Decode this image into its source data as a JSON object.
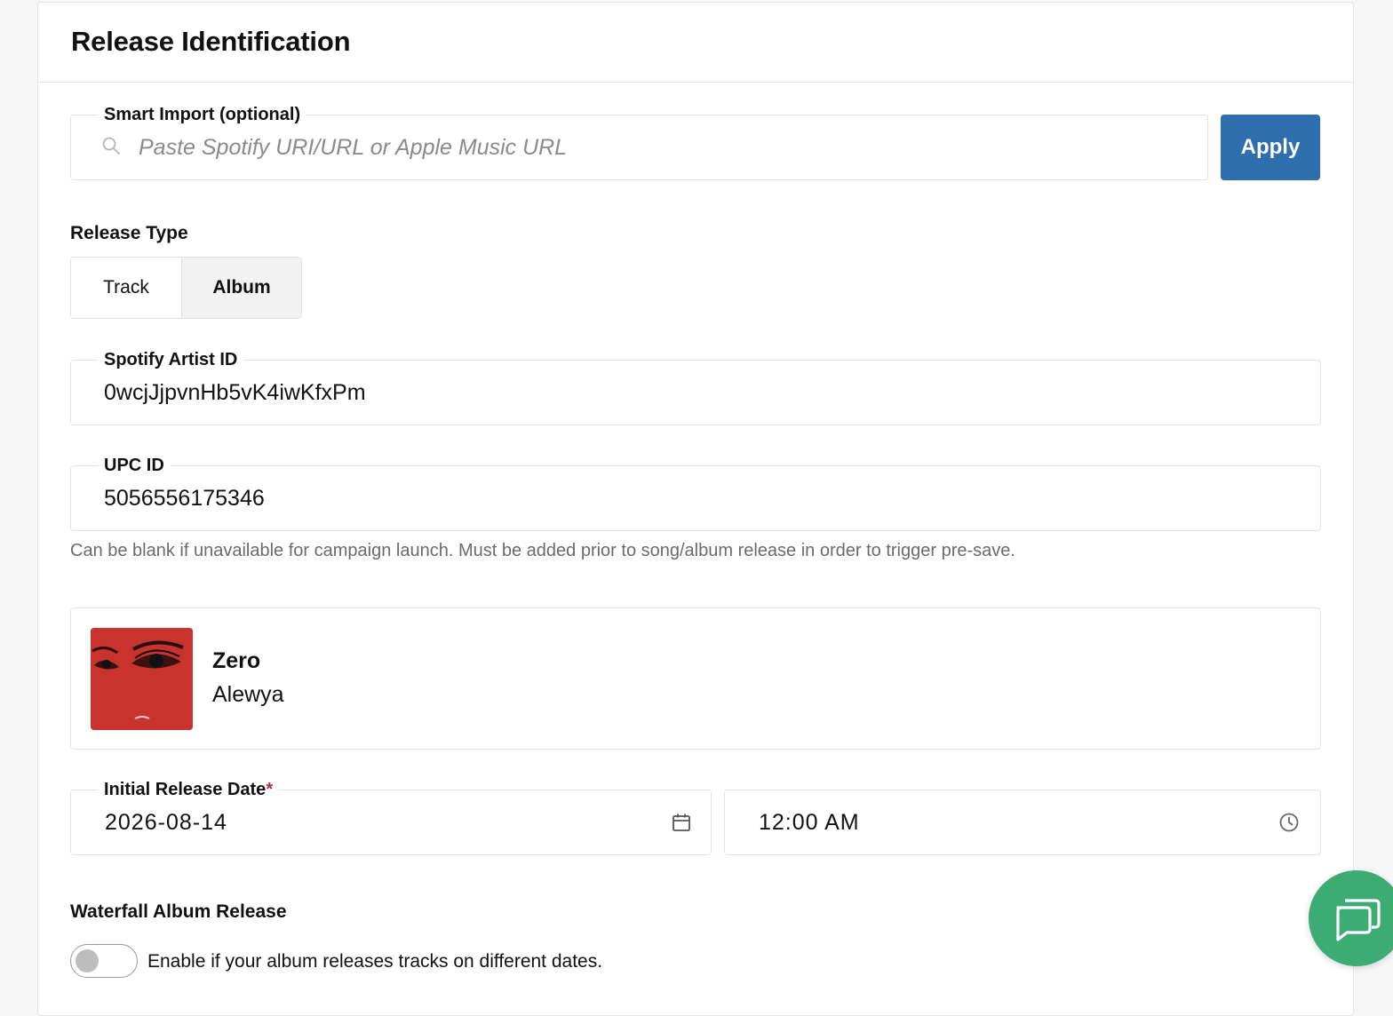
{
  "header": {
    "title": "Release Identification"
  },
  "smart_import": {
    "label": "Smart Import (optional)",
    "placeholder": "Paste Spotify URI/URL or Apple Music URL",
    "value": "",
    "apply_label": "Apply"
  },
  "release_type": {
    "label": "Release Type",
    "options": [
      "Track",
      "Album"
    ],
    "selected": "Album"
  },
  "spotify_artist": {
    "label": "Spotify Artist ID",
    "value": "0wcjJjpvnHb5vK4iwKfxPm"
  },
  "upc": {
    "label": "UPC ID",
    "value": "5056556175346",
    "helper": "Can be blank if unavailable for campaign launch. Must be added prior to song/album release in order to trigger pre-save."
  },
  "release_preview": {
    "title": "Zero",
    "artist": "Alewya",
    "cover_color": "#c9332e"
  },
  "initial_release": {
    "label": "Initial Release Date",
    "required_mark": "*",
    "date": "2026-08-14",
    "time": "12:00 AM",
    "date_icon": "calendar-icon",
    "time_icon": "clock-icon"
  },
  "waterfall": {
    "label": "Waterfall Album Release",
    "toggle_label": "Enable if your album releases tracks on different dates.",
    "enabled": false
  },
  "chat": {
    "icon": "chat-bubbles-icon",
    "color": "#3dab74"
  },
  "colors": {
    "primary": "#2f6fad",
    "required": "#c0272d",
    "border": "#e3e3e3"
  }
}
